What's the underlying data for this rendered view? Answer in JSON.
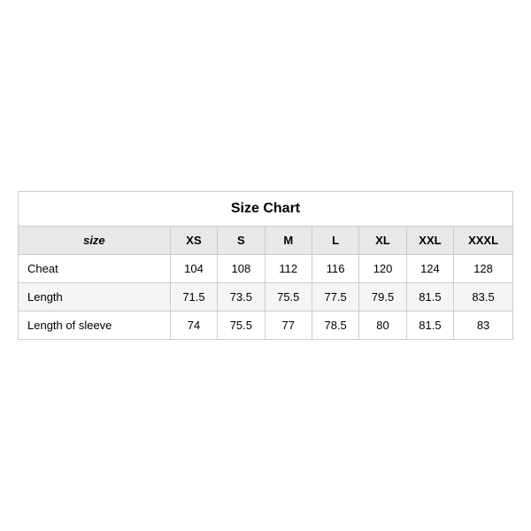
{
  "table": {
    "title": "Size Chart",
    "headers": [
      "size",
      "XS",
      "S",
      "M",
      "L",
      "XL",
      "XXL",
      "XXXL"
    ],
    "rows": [
      {
        "label": "Cheat",
        "values": [
          "104",
          "108",
          "112",
          "116",
          "120",
          "124",
          "128"
        ]
      },
      {
        "label": "Length",
        "values": [
          "71.5",
          "73.5",
          "75.5",
          "77.5",
          "79.5",
          "81.5",
          "83.5"
        ]
      },
      {
        "label": "Length of sleeve",
        "values": [
          "74",
          "75.5",
          "77",
          "78.5",
          "80",
          "81.5",
          "83"
        ]
      }
    ]
  }
}
